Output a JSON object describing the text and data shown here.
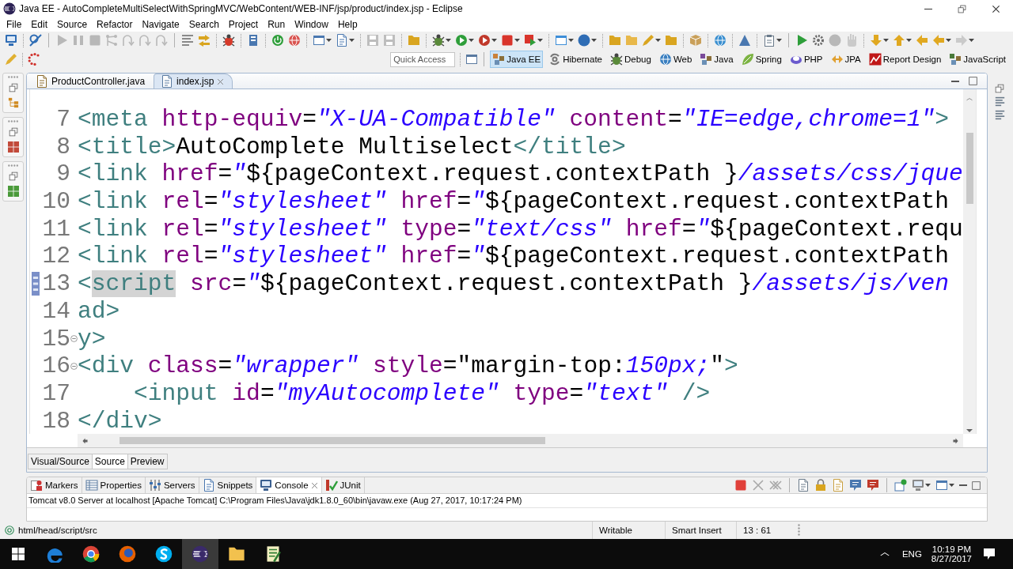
{
  "window": {
    "title": "Java EE - AutoCompleteMultiSelectWithSpringMVC/WebContent/WEB-INF/jsp/product/index.jsp - Eclipse"
  },
  "menu": [
    "File",
    "Edit",
    "Source",
    "Refactor",
    "Navigate",
    "Search",
    "Project",
    "Run",
    "Window",
    "Help"
  ],
  "quick_access": {
    "placeholder": "Quick Access"
  },
  "perspectives": [
    {
      "label": "Java EE",
      "selected": true
    },
    {
      "label": "Hibernate",
      "selected": false
    },
    {
      "label": "Debug",
      "selected": false
    },
    {
      "label": "Web",
      "selected": false
    },
    {
      "label": "Java",
      "selected": false
    },
    {
      "label": "Spring",
      "selected": false
    },
    {
      "label": "PHP",
      "selected": false
    },
    {
      "label": "JPA",
      "selected": false
    },
    {
      "label": "Report Design",
      "selected": false
    },
    {
      "label": "JavaScript",
      "selected": false
    }
  ],
  "editor": {
    "tabs": [
      {
        "label": "ProductController.java",
        "selected": false
      },
      {
        "label": "index.jsp",
        "selected": true
      }
    ],
    "lines": [
      {
        "number": "7",
        "current": false,
        "foldable": false,
        "tokens": [
          {
            "kind": "tag",
            "text": "<meta",
            "marked": false
          },
          {
            "kind": "attr",
            "text": " http-equiv",
            "marked": false
          },
          {
            "kind": "text",
            "text": "=",
            "marked": false
          },
          {
            "kind": "value",
            "text": "\"X-UA-Compatible\"",
            "marked": false
          },
          {
            "kind": "attr",
            "text": " content",
            "marked": false
          },
          {
            "kind": "text",
            "text": "=",
            "marked": false
          },
          {
            "kind": "value",
            "text": "\"IE=edge,chrome=1\"",
            "marked": false
          },
          {
            "kind": "tag",
            "text": ">",
            "marked": false
          }
        ]
      },
      {
        "number": "8",
        "current": false,
        "foldable": false,
        "tokens": [
          {
            "kind": "tag",
            "text": "<title>",
            "marked": false
          },
          {
            "kind": "text",
            "text": "AutoComplete Multiselect",
            "marked": false
          },
          {
            "kind": "tag",
            "text": "</title>",
            "marked": false
          }
        ]
      },
      {
        "number": "9",
        "current": false,
        "foldable": false,
        "tokens": [
          {
            "kind": "tag",
            "text": "<link",
            "marked": false
          },
          {
            "kind": "attr",
            "text": " href",
            "marked": false
          },
          {
            "kind": "text",
            "text": "=",
            "marked": false
          },
          {
            "kind": "value",
            "text": "\"",
            "marked": false
          },
          {
            "kind": "el",
            "text": "${pageContext.request.contextPath }",
            "marked": false
          },
          {
            "kind": "value",
            "text": "/assets/css/jque",
            "marked": false
          }
        ]
      },
      {
        "number": "10",
        "current": false,
        "foldable": false,
        "tokens": [
          {
            "kind": "tag",
            "text": "<link",
            "marked": false
          },
          {
            "kind": "attr",
            "text": " rel",
            "marked": false
          },
          {
            "kind": "text",
            "text": "=",
            "marked": false
          },
          {
            "kind": "value",
            "text": "\"stylesheet\"",
            "marked": false
          },
          {
            "kind": "attr",
            "text": " href",
            "marked": false
          },
          {
            "kind": "text",
            "text": "=",
            "marked": false
          },
          {
            "kind": "value",
            "text": "\"",
            "marked": false
          },
          {
            "kind": "el",
            "text": "${pageContext.request.contextPath",
            "marked": false
          }
        ]
      },
      {
        "number": "11",
        "current": false,
        "foldable": false,
        "tokens": [
          {
            "kind": "tag",
            "text": "<link",
            "marked": false
          },
          {
            "kind": "attr",
            "text": " rel",
            "marked": false
          },
          {
            "kind": "text",
            "text": "=",
            "marked": false
          },
          {
            "kind": "value",
            "text": "\"stylesheet\"",
            "marked": false
          },
          {
            "kind": "attr",
            "text": " type",
            "marked": false
          },
          {
            "kind": "text",
            "text": "=",
            "marked": false
          },
          {
            "kind": "value",
            "text": "\"text/css\"",
            "marked": false
          },
          {
            "kind": "attr",
            "text": " href",
            "marked": false
          },
          {
            "kind": "text",
            "text": "=",
            "marked": false
          },
          {
            "kind": "value",
            "text": "\"",
            "marked": false
          },
          {
            "kind": "el",
            "text": "${pageContext.requ",
            "marked": false
          }
        ]
      },
      {
        "number": "12",
        "current": false,
        "foldable": false,
        "tokens": [
          {
            "kind": "tag",
            "text": "<link",
            "marked": false
          },
          {
            "kind": "attr",
            "text": " rel",
            "marked": false
          },
          {
            "kind": "text",
            "text": "=",
            "marked": false
          },
          {
            "kind": "value",
            "text": "\"stylesheet\"",
            "marked": false
          },
          {
            "kind": "attr",
            "text": " href",
            "marked": false
          },
          {
            "kind": "text",
            "text": "=",
            "marked": false
          },
          {
            "kind": "value",
            "text": "\"",
            "marked": false
          },
          {
            "kind": "el",
            "text": "${pageContext.request.contextPath",
            "marked": false
          }
        ]
      },
      {
        "number": "13",
        "current": true,
        "foldable": false,
        "tokens": [
          {
            "kind": "tag",
            "text": "<",
            "marked": false
          },
          {
            "kind": "tag",
            "text": "script",
            "marked": true
          },
          {
            "kind": "attr",
            "text": " src",
            "marked": false
          },
          {
            "kind": "text",
            "text": "=",
            "marked": false
          },
          {
            "kind": "value",
            "text": "\"",
            "marked": false
          },
          {
            "kind": "el",
            "text": "${pageContext.request.contextPath }",
            "marked": false
          },
          {
            "kind": "value",
            "text": "/assets/js/ven",
            "marked": false
          }
        ]
      },
      {
        "number": "14",
        "current": false,
        "foldable": false,
        "tokens": [
          {
            "kind": "tag",
            "text": "ad>",
            "marked": false
          }
        ]
      },
      {
        "number": "15",
        "current": false,
        "foldable": true,
        "tokens": [
          {
            "kind": "tag",
            "text": "y>",
            "marked": false
          }
        ]
      },
      {
        "number": "16",
        "current": false,
        "foldable": true,
        "tokens": [
          {
            "kind": "tag",
            "text": "<div",
            "marked": false
          },
          {
            "kind": "attr",
            "text": " class",
            "marked": false
          },
          {
            "kind": "text",
            "text": "=",
            "marked": false
          },
          {
            "kind": "value",
            "text": "\"wrapper\"",
            "marked": false
          },
          {
            "kind": "attr",
            "text": " style",
            "marked": false
          },
          {
            "kind": "text",
            "text": "=",
            "marked": false
          },
          {
            "kind": "text",
            "text": "\"margin-top:",
            "marked": false
          },
          {
            "kind": "value",
            "text": "150px;",
            "marked": false
          },
          {
            "kind": "text",
            "text": "\"",
            "marked": false
          },
          {
            "kind": "tag",
            "text": ">",
            "marked": false
          }
        ]
      },
      {
        "number": "17",
        "current": false,
        "foldable": false,
        "tokens": [
          {
            "kind": "tag",
            "text": "    <input",
            "marked": false
          },
          {
            "kind": "attr",
            "text": " id",
            "marked": false
          },
          {
            "kind": "text",
            "text": "=",
            "marked": false
          },
          {
            "kind": "value",
            "text": "\"myAutocomplete\"",
            "marked": false
          },
          {
            "kind": "attr",
            "text": " type",
            "marked": false
          },
          {
            "kind": "text",
            "text": "=",
            "marked": false
          },
          {
            "kind": "value",
            "text": "\"text\"",
            "marked": false
          },
          {
            "kind": "tag",
            "text": " />",
            "marked": false
          }
        ]
      },
      {
        "number": "18",
        "current": false,
        "foldable": false,
        "tokens": [
          {
            "kind": "tag",
            "text": "</div>",
            "marked": false
          }
        ]
      }
    ],
    "mode_tabs": [
      {
        "label": "Visual/Source",
        "selected": false
      },
      {
        "label": "Source",
        "selected": true
      },
      {
        "label": "Preview",
        "selected": false
      }
    ]
  },
  "bottom_panel": {
    "tabs": [
      {
        "label": "Markers",
        "selected": false
      },
      {
        "label": "Properties",
        "selected": false
      },
      {
        "label": "Servers",
        "selected": false
      },
      {
        "label": "Snippets",
        "selected": false
      },
      {
        "label": "Console",
        "selected": true
      },
      {
        "label": "JUnit",
        "selected": false
      }
    ],
    "console_title": "Tomcat v8.0 Server at localhost [Apache Tomcat] C:\\Program Files\\Java\\jdk1.8.0_60\\bin\\javaw.exe (Aug 27, 2017, 10:17:24 PM)"
  },
  "status_bar": {
    "path": "html/head/script/src",
    "fields": [
      "Writable",
      "Smart Insert",
      "13 : 61"
    ]
  },
  "taskbar": {
    "language": "ENG",
    "time": "10:19 PM",
    "date": "8/27/2017"
  }
}
